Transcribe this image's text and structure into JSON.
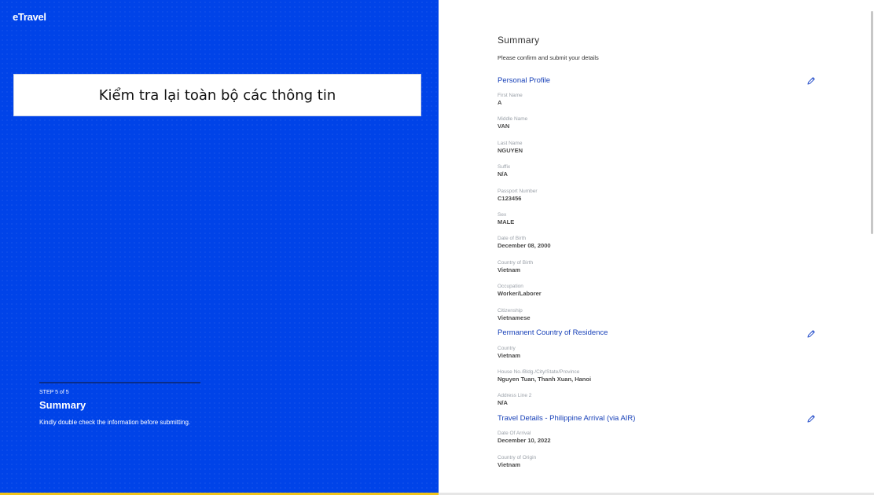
{
  "brand": {
    "logo_text": "eTravel"
  },
  "callout": {
    "text": "Kiểm tra lại toàn bộ các thông tin"
  },
  "step": {
    "label": "STEP 5 of 5",
    "title": "Summary",
    "description": "Kindly double check the information before submitting."
  },
  "summary": {
    "title": "Summary",
    "subtitle": "Please confirm and submit your details"
  },
  "sections": [
    {
      "title": "Personal Profile",
      "fields": [
        {
          "label": "First Name",
          "value": "A"
        },
        {
          "label": "Middle Name",
          "value": "VAN"
        },
        {
          "label": "Last Name",
          "value": "NGUYEN"
        },
        {
          "label": "Suffix",
          "value": "N/A"
        },
        {
          "label": "Passport Number",
          "value": "C123456"
        },
        {
          "label": "Sex",
          "value": "MALE"
        },
        {
          "label": "Date of Birth",
          "value": "December 08, 2000"
        },
        {
          "label": "Country of Birth",
          "value": "Vietnam"
        },
        {
          "label": "Occupation",
          "value": "Worker/Laborer"
        },
        {
          "label": "Citizenship",
          "value": "Vietnamese"
        }
      ]
    },
    {
      "title": "Permanent Country of Residence",
      "fields": [
        {
          "label": "Country",
          "value": "Vietnam"
        },
        {
          "label": "House No./Bldg./City/State/Province",
          "value": "Nguyen Tuan, Thanh Xuan, Hanoi"
        },
        {
          "label": "Address Line 2",
          "value": "N/A"
        }
      ]
    },
    {
      "title": "Travel Details - Philippine Arrival (via AIR)",
      "fields": [
        {
          "label": "Date Of Arrival",
          "value": "December 10, 2022"
        },
        {
          "label": "Country of Origin",
          "value": "Vietnam"
        }
      ]
    }
  ],
  "colors": {
    "left_panel": "#0043e8",
    "section_title": "#1740b8",
    "accent_bar": "#f0c419"
  },
  "icons": {
    "edit": "pencil-icon"
  }
}
